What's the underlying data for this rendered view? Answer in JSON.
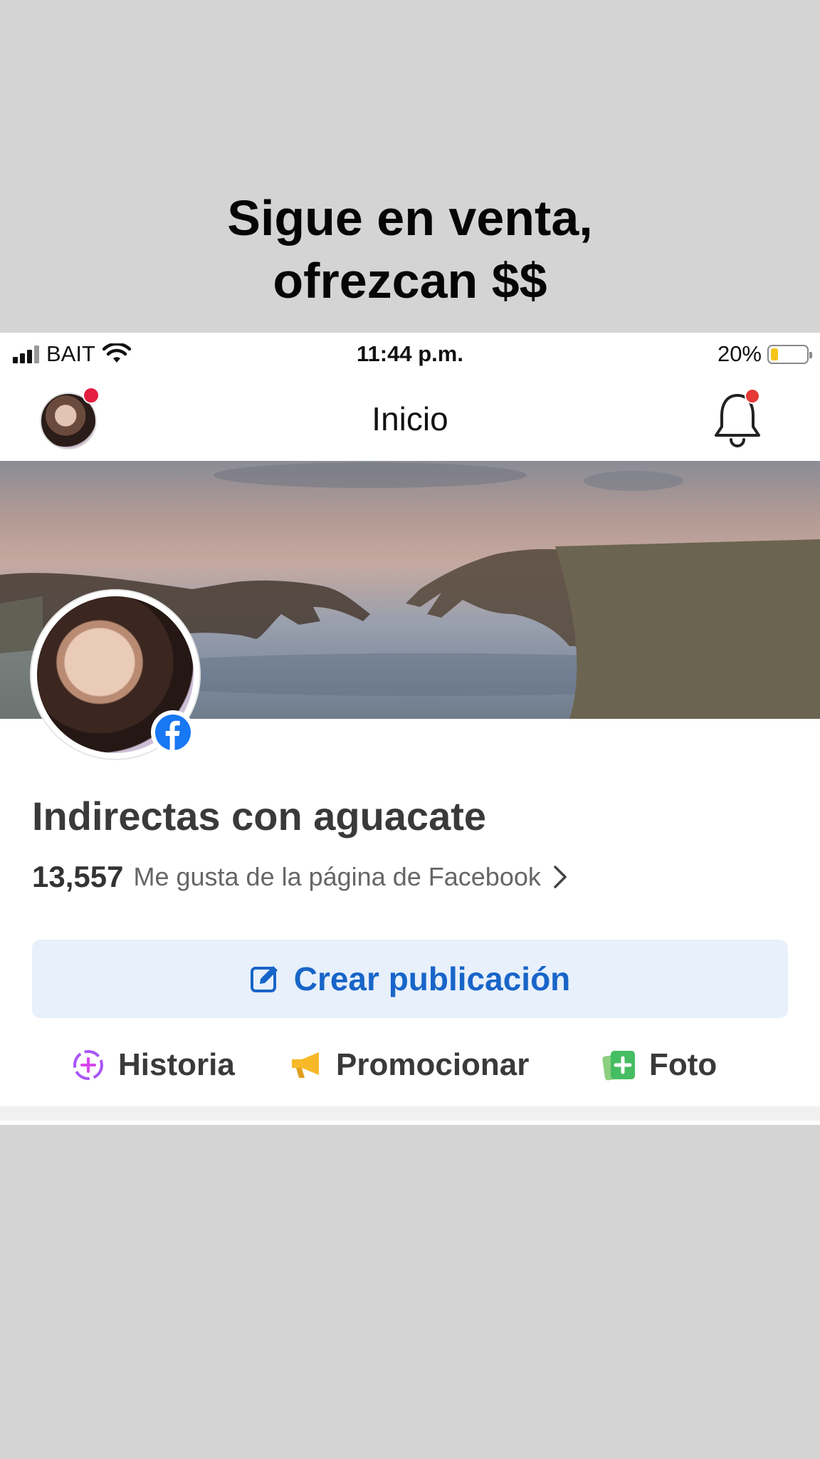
{
  "caption": {
    "line1": "Sigue en venta,",
    "line2": "ofrezcan $$"
  },
  "status_bar": {
    "carrier": "BAIT",
    "time": "11:44 p.m.",
    "battery_text": "20%",
    "battery_level": 0.2,
    "battery_color": "#f5c518"
  },
  "header": {
    "title": "Inicio",
    "notification_dot_color": "#e53935"
  },
  "page": {
    "name": "Indirectas con aguacate",
    "likes_count": "13,557",
    "likes_label": "Me gusta de la página de Facebook"
  },
  "create_post": {
    "label": "Crear publicación",
    "color": "#1865c8"
  },
  "actions": [
    {
      "label": "Historia",
      "icon": "story-icon"
    },
    {
      "label": "Promocionar",
      "icon": "megaphone-icon"
    },
    {
      "label": "Foto",
      "icon": "photo-icon"
    }
  ],
  "colors": {
    "facebook_blue": "#1877f2",
    "background": "#d4d4d4"
  }
}
